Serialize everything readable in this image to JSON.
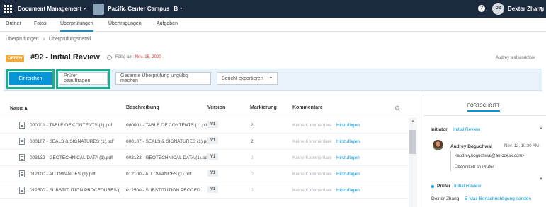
{
  "topbar": {
    "app_name": "Document Management",
    "project_name": "Pacific Center Campus",
    "project_badge": "B",
    "help": "?",
    "user_initials": "DZ",
    "user_name": "Dexter Zhang"
  },
  "tabs": [
    "Ordner",
    "Fotos",
    "Überprüfungen",
    "Übertragungen",
    "Aufgaben"
  ],
  "active_tab": "Überprüfungen",
  "breadcrumb": [
    "Überprüfungen",
    "›",
    "Überprüfungsdetail"
  ],
  "review": {
    "status": "OFFEN",
    "title": "#92 - Initial Review",
    "due_label": "Fällig am:",
    "due_date": "Nov. 15, 2020",
    "workflow": "Audrey test workflow"
  },
  "toolbar": {
    "submit": "Einreichen",
    "assign_reviewer": "Prüfer beauftragen",
    "invalidate": "Gesamte Überprüfung ungültig machen",
    "export": "Bericht exportieren"
  },
  "table": {
    "headers": {
      "name": "Name",
      "description": "Beschreibung",
      "version": "Version",
      "markup": "Markierung",
      "comments": "Kommentare"
    },
    "rows": [
      {
        "name": "000001 - TABLE OF CONTENTS (1).pdf",
        "description": "000001 - TABLE OF CONTENTS (1).pdf",
        "version": "V1",
        "markup": "2",
        "comments": "Keine Kommentare",
        "add": "Hinzufügen"
      },
      {
        "name": "000107 - SEALS & SIGNATURES (1).pdf",
        "description": "000107 - SEALS & SIGNATURES (1).pdf",
        "version": "V1",
        "markup": "2",
        "comments": "Keine Kommentare",
        "add": "Hinzufügen"
      },
      {
        "name": "003132 - GEOTECHNICAL DATA (1).pdf",
        "description": "003132 - GEOTECHNICAL DATA (1).pdf",
        "version": "V1",
        "markup": "0",
        "comments": "Keine Kommentare",
        "add": "Hinzufügen"
      },
      {
        "name": "012100 - ALLOWANCES (1).pdf",
        "description": "012100 - ALLOWANCES (1).pdf",
        "version": "V1",
        "markup": "0",
        "comments": "Keine Kommentare",
        "add": "Hinzufügen"
      },
      {
        "name": "012500 - SUBSTITUTION PROCEDURES (…",
        "description": "012500 - SUBSTITUTION PROCED…",
        "version": "V1",
        "markup": "0",
        "comments": "Keine Kommentare",
        "add": "Hinzufügen"
      }
    ]
  },
  "progress": {
    "tab_label": "FORTSCHRITT",
    "initiator_label": "Initiator",
    "initiator_step": "Initial Review",
    "initiator_name": "Audrey Boguchwal",
    "initiator_time": "Nov. 12, 10:30 AM",
    "initiator_email": "<audrey.boguchwal@autodesk.com>",
    "initiator_status": "Übermittelt an Prüfer",
    "reviewer_label": "Prüfer",
    "reviewer_step": "Initial Review",
    "reviewer_name": "Dexter Zhang",
    "reviewer_action": "E-Mail-Benachrichtigung senden"
  },
  "colors": {
    "topbar": "#1c2a3f",
    "accent": "#0696d7",
    "status_open": "#f3a83a",
    "due_red": "#e0352f",
    "highlight": "#1cae8f"
  }
}
